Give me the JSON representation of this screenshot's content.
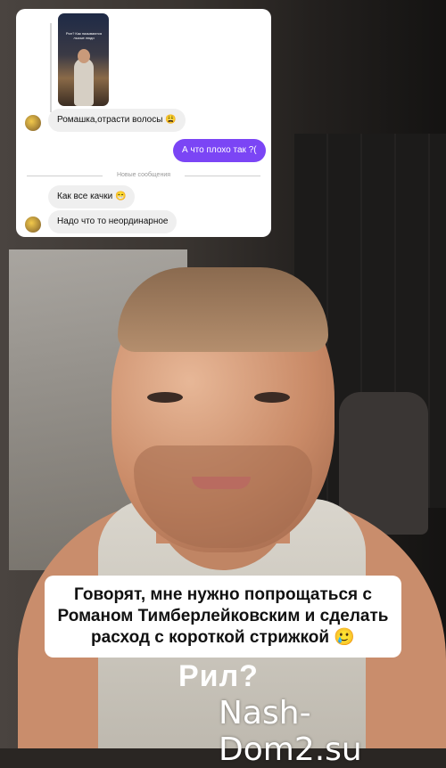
{
  "chat": {
    "story_preview_text": "Рил? Как называются лысые люди",
    "messages": [
      {
        "direction": "incoming",
        "text": "Ромашка,отрасти волосы 😩"
      },
      {
        "direction": "outgoing",
        "text": "А что плохо так ?("
      },
      {
        "direction": "incoming",
        "text": "Как все качки 😁"
      },
      {
        "direction": "incoming",
        "text": "Надо что то неординарное"
      }
    ],
    "divider_label": "Новые сообщения",
    "accent_color": "#7b45f5"
  },
  "caption": {
    "text": "Говорят, мне нужно попрощаться с Романом Тимберлейковским и сделать расход с короткой стрижкой 🥲"
  },
  "overlay_text": "Рил?",
  "watermark": "Nash-Dom2.su"
}
